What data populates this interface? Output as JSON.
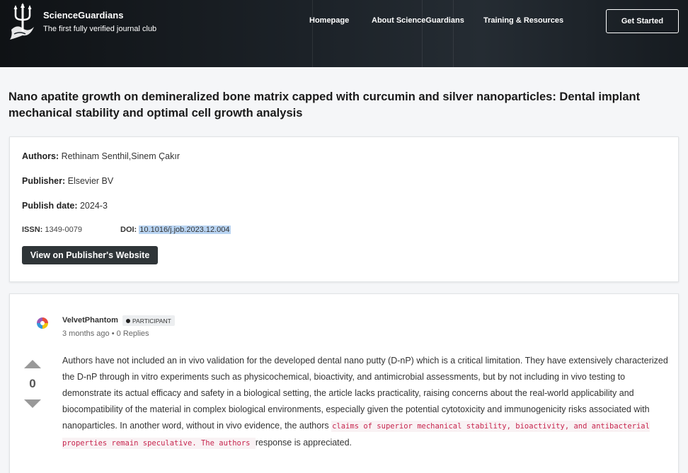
{
  "header": {
    "brand_name": "ScienceGuardians",
    "brand_tagline": "The first fully verified journal club",
    "nav": [
      "Homepage",
      "About ScienceGuardians",
      "Training & Resources"
    ],
    "cta_label": "Get Started"
  },
  "article": {
    "title": "Nano apatite growth on demineralized bone matrix capped with curcumin and silver nanoparticles: Dental implant mechanical stability and optimal cell growth analysis",
    "authors_label": "Authors:",
    "authors": "Rethinam Senthil,Sinem Çakır",
    "publisher_label": "Publisher:",
    "publisher": "Elsevier BV",
    "publish_date_label": "Publish date:",
    "publish_date": "2024-3",
    "issn_label": "ISSN:",
    "issn": "1349-0079",
    "doi_label": "DOI:",
    "doi": "10.1016/j.job.2023.12.004",
    "publisher_button": "View on Publisher's Website"
  },
  "comment": {
    "username": "VelvetPhantom",
    "badge": "PARTICIPANT",
    "time": "3 months ago",
    "separator": "•",
    "replies": "0 Replies",
    "votes": "0",
    "body_text": "Authors have not included an in vivo validation for the developed dental nano putty (D-nP) which is a critical limitation. They have extensively characterized the D-nP through in vitro experiments such as physicochemical, bioactivity, and antimicrobial assessments, but by not including in vivo testing to demonstrate its actual efficacy and safety in a biological setting, the article lacks practicality, raising concerns about the real-world applicability and biocompatibility of the material in complex biological environments, especially given the potential cytotoxicity and immunogenicity risks associated with nanoparticles. In another word, without in vivo evidence, the authors ",
    "body_code": "claims of superior mechanical stability, bioactivity, and antibacterial properties remain speculative. The authors ",
    "body_tail": " response is appreciated."
  }
}
